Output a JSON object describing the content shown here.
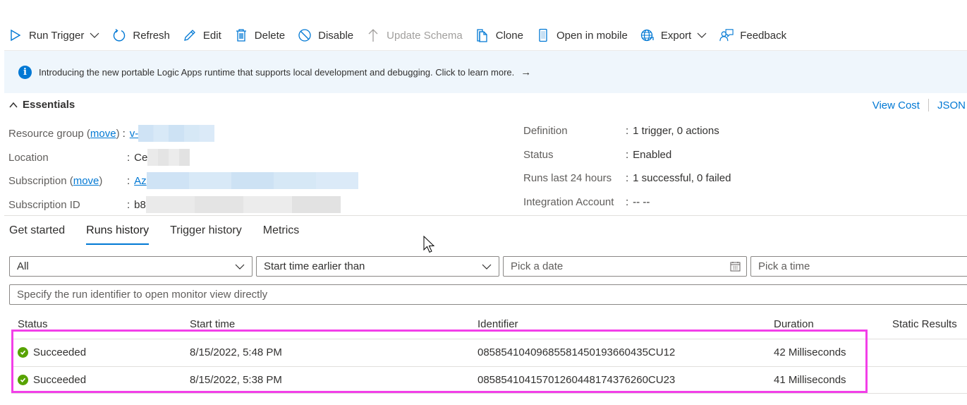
{
  "toolbar": {
    "items": [
      {
        "label": "Run Trigger",
        "icon": "play-icon",
        "has_dropdown": true,
        "disabled": false
      },
      {
        "label": "Refresh",
        "icon": "refresh-icon",
        "has_dropdown": false,
        "disabled": false
      },
      {
        "label": "Edit",
        "icon": "pencil-icon",
        "has_dropdown": false,
        "disabled": false
      },
      {
        "label": "Delete",
        "icon": "trash-icon",
        "has_dropdown": false,
        "disabled": false
      },
      {
        "label": "Disable",
        "icon": "block-icon",
        "has_dropdown": false,
        "disabled": false
      },
      {
        "label": "Update Schema",
        "icon": "arrow-up-icon",
        "has_dropdown": false,
        "disabled": true
      },
      {
        "label": "Clone",
        "icon": "copy-icon",
        "has_dropdown": false,
        "disabled": false
      },
      {
        "label": "Open in mobile",
        "icon": "mobile-icon",
        "has_dropdown": false,
        "disabled": false
      },
      {
        "label": "Export",
        "icon": "globe-export-icon",
        "has_dropdown": true,
        "disabled": false
      },
      {
        "label": "Feedback",
        "icon": "feedback-icon",
        "has_dropdown": false,
        "disabled": false
      }
    ]
  },
  "banner": {
    "text": "Introducing the new portable Logic Apps runtime that supports local development and debugging. Click to learn more.",
    "arrow": "→"
  },
  "essentials": {
    "title": "Essentials",
    "view_cost": "View Cost",
    "json": "JSON",
    "left": [
      {
        "label": "Resource group",
        "move": "move",
        "value": "v-",
        "link": true
      },
      {
        "label": "Location",
        "move": null,
        "value": "Ce",
        "link": false
      },
      {
        "label": "Subscription",
        "move": "move",
        "value": "Az",
        "link": true
      },
      {
        "label": "Subscription ID",
        "move": null,
        "value": "b8",
        "link": false
      }
    ],
    "right": [
      {
        "label": "Definition",
        "value": "1 trigger, 0 actions"
      },
      {
        "label": "Status",
        "value": "Enabled"
      },
      {
        "label": "Runs last 24 hours",
        "value": "1 successful, 0 failed"
      },
      {
        "label": "Integration Account",
        "value": "-- --"
      }
    ]
  },
  "tabs": [
    {
      "label": "Get started",
      "active": false
    },
    {
      "label": "Runs history",
      "active": true
    },
    {
      "label": "Trigger history",
      "active": false
    },
    {
      "label": "Metrics",
      "active": false
    }
  ],
  "filters": {
    "status_value": "All",
    "time_filter_value": "Start time earlier than",
    "date_placeholder": "Pick a date",
    "time_placeholder": "Pick a time",
    "identifier_placeholder": "Specify the run identifier to open monitor view directly"
  },
  "table": {
    "columns": [
      "Status",
      "Start time",
      "Identifier",
      "Duration",
      "Static Results"
    ],
    "rows": [
      {
        "status": "Succeeded",
        "start_time": "8/15/2022, 5:48 PM",
        "identifier": "08585410409685581450193660435CU12",
        "duration": "42 Milliseconds",
        "static_results": ""
      },
      {
        "status": "Succeeded",
        "start_time": "8/15/2022, 5:38 PM",
        "identifier": "08585410415701260448174376260CU23",
        "duration": "41 Milliseconds",
        "static_results": ""
      }
    ]
  },
  "colors": {
    "accent": "#0078d4",
    "success": "#57a300",
    "highlight": "#f23fe8",
    "banner_bg": "#eff6fc"
  }
}
